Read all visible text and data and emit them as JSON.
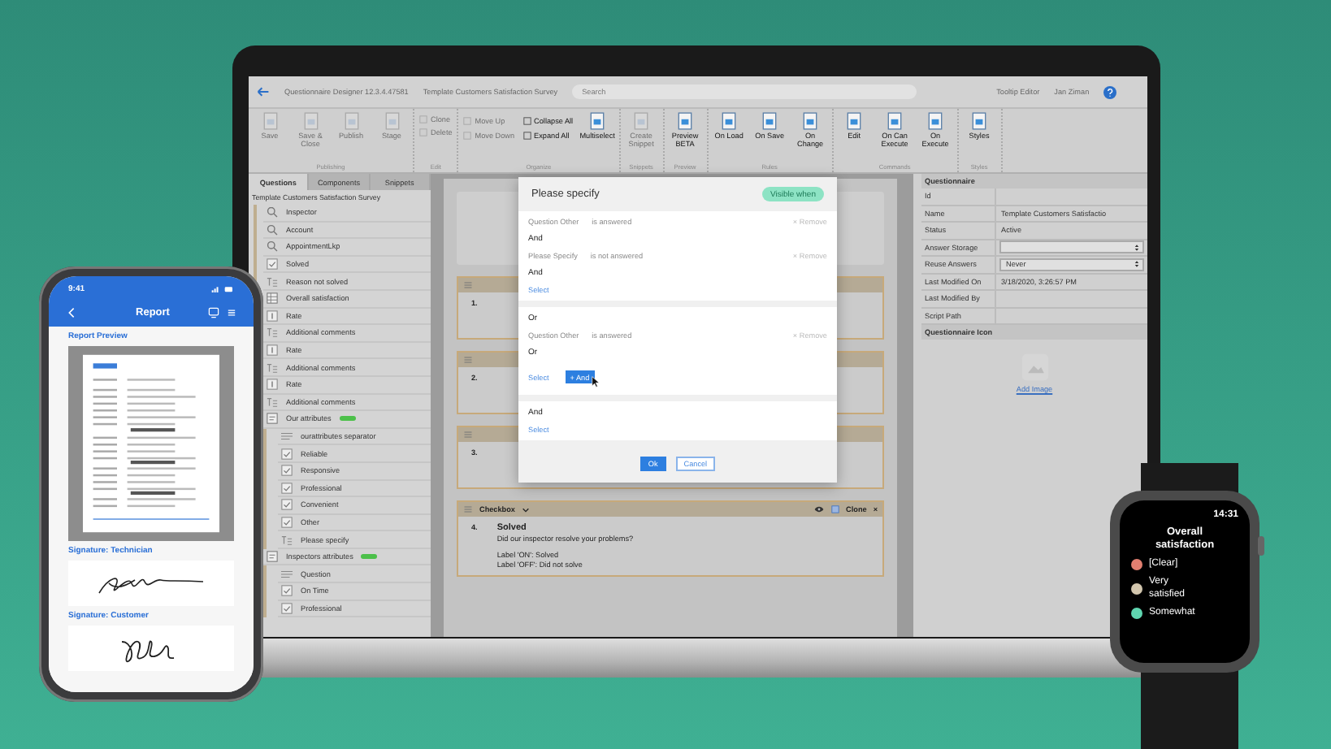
{
  "laptop": {
    "title_bar": {
      "app_title": "Questionnaire Designer 12.3.4.47581",
      "document_title": "Template Customers Satisfaction Survey",
      "search_placeholder": "Search",
      "tooltip_editor": "Tooltip Editor",
      "user": "Jan Ziman"
    },
    "ribbon": [
      {
        "label": "Publishing",
        "items": [
          {
            "label": "Save",
            "kind": "large",
            "disabled": true
          },
          {
            "label": "Save & Close",
            "kind": "large",
            "disabled": true
          },
          {
            "label": "Publish",
            "kind": "large",
            "disabled": true
          },
          {
            "label": "Stage",
            "kind": "large",
            "disabled": true
          }
        ]
      },
      {
        "label": "Edit",
        "items": [
          {
            "label": "Clone",
            "kind": "small",
            "disabled": true
          },
          {
            "label": "Delete",
            "kind": "small",
            "disabled": true
          }
        ]
      },
      {
        "label": "Organize",
        "items": [
          {
            "label": "Move Up",
            "kind": "small",
            "disabled": true
          },
          {
            "label": "Move Down",
            "kind": "small",
            "disabled": true
          },
          {
            "label": "Collapse All",
            "kind": "small",
            "disabled": false
          },
          {
            "label": "Expand All",
            "kind": "small",
            "disabled": false
          },
          {
            "label": "Multiselect",
            "kind": "large",
            "disabled": false
          }
        ]
      },
      {
        "label": "Snippets",
        "items": [
          {
            "label": "Create Snippet",
            "kind": "large",
            "disabled": true
          }
        ]
      },
      {
        "label": "Preview",
        "items": [
          {
            "label": "Preview BETA",
            "kind": "large",
            "disabled": false
          }
        ]
      },
      {
        "label": "Rules",
        "items": [
          {
            "label": "On Load",
            "kind": "large",
            "disabled": false
          },
          {
            "label": "On Save",
            "kind": "large",
            "disabled": false
          },
          {
            "label": "On Change",
            "kind": "large",
            "disabled": false
          }
        ]
      },
      {
        "label": "Commands",
        "items": [
          {
            "label": "Edit",
            "kind": "large",
            "disabled": false
          },
          {
            "label": "On Can Execute",
            "kind": "large",
            "disabled": false
          },
          {
            "label": "On Execute",
            "kind": "large",
            "disabled": false
          }
        ]
      },
      {
        "label": "Styles",
        "items": [
          {
            "label": "Styles",
            "kind": "large",
            "disabled": false
          }
        ]
      }
    ],
    "left_panel": {
      "tabs": [
        {
          "label": "Questions",
          "selected": true
        },
        {
          "label": "Components",
          "selected": false
        },
        {
          "label": "Snippets",
          "selected": false
        }
      ],
      "tree_title": "Template Customers Satisfaction Survey",
      "items": [
        {
          "label": "Inspector",
          "kind": "search"
        },
        {
          "label": "Account",
          "kind": "search"
        },
        {
          "label": "AppointmentLkp",
          "kind": "search"
        },
        {
          "label": "Solved",
          "kind": "checkbox"
        },
        {
          "label": "Reason not solved",
          "kind": "text"
        },
        {
          "label": "Overall satisfaction",
          "kind": "matrix"
        },
        {
          "label": "Rate",
          "kind": "rating"
        },
        {
          "label": "Additional comments",
          "kind": "text"
        },
        {
          "label": "Rate",
          "kind": "rating"
        },
        {
          "label": "Additional comments",
          "kind": "text"
        },
        {
          "label": "Rate",
          "kind": "rating"
        },
        {
          "label": "Additional comments",
          "kind": "text"
        },
        {
          "label": "Our attributes",
          "kind": "group",
          "flagged": true,
          "children": [
            {
              "label": "ourattributes separator",
              "kind": "separator"
            },
            {
              "label": "Reliable",
              "kind": "checkbox"
            },
            {
              "label": "Responsive",
              "kind": "checkbox"
            },
            {
              "label": "Professional",
              "kind": "checkbox"
            },
            {
              "label": "Convenient",
              "kind": "checkbox"
            },
            {
              "label": "Other",
              "kind": "checkbox"
            },
            {
              "label": "Please specify",
              "kind": "text"
            }
          ]
        },
        {
          "label": "Inspectors attributes",
          "kind": "group",
          "flagged": true,
          "children": [
            {
              "label": "Question",
              "kind": "separator"
            },
            {
              "label": "On Time",
              "kind": "checkbox"
            },
            {
              "label": "Professional",
              "kind": "checkbox"
            }
          ]
        }
      ]
    },
    "cards": [
      {
        "number": "1."
      },
      {
        "number": "2."
      },
      {
        "number": "3."
      },
      {
        "number": "4.",
        "type_label": "Checkbox",
        "clone": "Clone",
        "close": "×",
        "title": "Solved",
        "question": "Did our inspector resolve your problems?",
        "lines": [
          "Label 'ON': Solved",
          "Label 'OFF': Did not solve"
        ]
      }
    ],
    "dialog": {
      "title": "Please specify",
      "badge": "Visible when",
      "sections": [
        [
          {
            "kind": "condition",
            "question": "Question Other",
            "operator": "is answered",
            "remove": "× Remove"
          },
          {
            "kind": "connector",
            "text": "And"
          },
          {
            "kind": "condition",
            "question": "Please Specify",
            "operator": "is not answered",
            "remove": "× Remove"
          },
          {
            "kind": "connector",
            "text": "And"
          },
          {
            "kind": "actions",
            "select": "Select"
          }
        ],
        [
          {
            "kind": "connector",
            "text": "Or"
          },
          {
            "kind": "condition",
            "question": "Question Other",
            "operator": "is answered",
            "remove": "× Remove"
          },
          {
            "kind": "connector",
            "text": "Or"
          },
          {
            "kind": "actions",
            "select": "Select",
            "add": "+ And"
          }
        ],
        [
          {
            "kind": "connector",
            "text": "And"
          },
          {
            "kind": "actions",
            "select": "Select"
          }
        ]
      ],
      "ok": "Ok",
      "cancel": "Cancel"
    },
    "right_panel": {
      "header": "Questionnaire",
      "properties": [
        {
          "name": "Id",
          "kind": "text"
        },
        {
          "name": "Name",
          "kind": "text",
          "value": "Template Customers Satisfactio"
        },
        {
          "name": "Status",
          "kind": "text",
          "value": "Active"
        },
        {
          "name": "Answer Storage",
          "kind": "select"
        },
        {
          "name": "Reuse Answers",
          "kind": "select",
          "value": "Never"
        },
        {
          "name": "Last Modified On",
          "kind": "text",
          "value": "3/18/2020, 3:26:57 PM"
        },
        {
          "name": "Last Modified By",
          "kind": "text"
        },
        {
          "name": "Script Path",
          "kind": "text"
        }
      ],
      "icon_section": "Questionnaire Icon",
      "add_image": "Add Image"
    }
  },
  "phone": {
    "time": "9:41",
    "title": "Report",
    "preview_label": "Report Preview",
    "signatures": [
      {
        "label": "Signature: Technician"
      },
      {
        "label": "Signature: Customer"
      }
    ]
  },
  "watch": {
    "time": "14:31",
    "title": "Overall satisfaction",
    "options": [
      {
        "label": "[Clear]",
        "color": "#e27f70"
      },
      {
        "label": "Very satisfied",
        "color": "#d2c6ad"
      },
      {
        "label": "Somewhat",
        "color": "#5fd6b0"
      }
    ]
  }
}
